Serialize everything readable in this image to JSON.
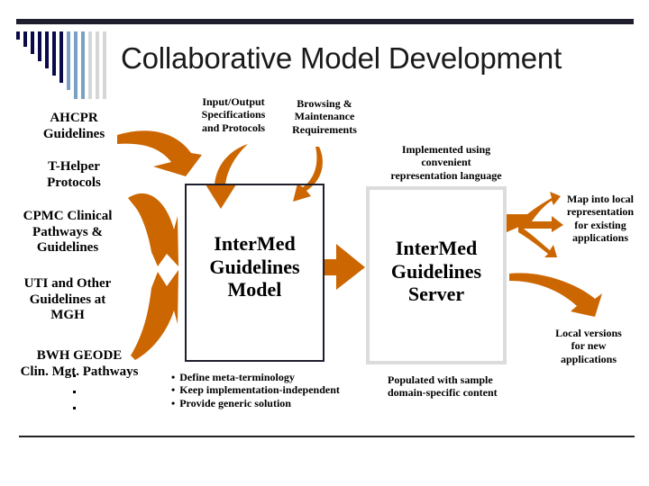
{
  "slide": {
    "title": "Collaborative Model Development",
    "accent_color": "#cc6600",
    "sources": [
      {
        "lines": [
          "AHCPR",
          "Guidelines"
        ]
      },
      {
        "lines": [
          "T-Helper",
          "Protocols"
        ]
      },
      {
        "lines": [
          "CPMC Clinical",
          "Pathways &",
          "Guidelines"
        ]
      },
      {
        "lines": [
          "UTI and Other",
          "Guidelines at",
          "MGH"
        ]
      },
      {
        "lines": [
          "BWH GEODE",
          "Clin. Mgt. Pathways"
        ]
      }
    ],
    "inputs": {
      "io_spec": [
        "Input/Output",
        "Specifications",
        "and Protocols"
      ],
      "browsing": [
        "Browsing &",
        "Maintenance",
        "Requirements"
      ]
    },
    "model_box": {
      "lines": [
        "InterMed",
        "Guidelines",
        "Model"
      ],
      "bullets": [
        "Define meta-terminology",
        "Keep implementation-independent",
        "Provide generic solution"
      ]
    },
    "server_box": {
      "header": [
        "Implemented using",
        "convenient",
        "representation language"
      ],
      "lines": [
        "InterMed",
        "Guidelines",
        "Server"
      ],
      "footer": [
        "Populated with sample",
        "domain-specific content"
      ]
    },
    "outputs": {
      "map_local": [
        "Map into local",
        "representation",
        "for existing",
        "applications"
      ],
      "local_versions": [
        "Local versions",
        "for new",
        "applications"
      ]
    }
  }
}
